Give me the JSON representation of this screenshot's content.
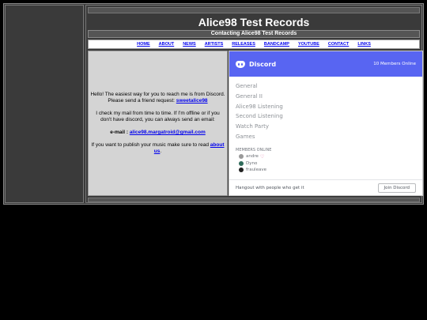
{
  "header": {
    "title": "Alice98 Test Records",
    "subtitle": "Contacting Alice98 Test Records"
  },
  "nav": {
    "items": [
      "HOME",
      "ABOUT",
      "NEWS",
      "ARTISTS",
      "RELEASES",
      "BANDCAMP",
      "YOUTUBE",
      "CONTACT",
      "LINKS"
    ]
  },
  "content": {
    "intro": "Hello! The easiest way for you to reach me is from Discord. Please send a friend request: ",
    "discord_user": "sweetalice98",
    "mail_text": "I check my mail from time to time. If I'm offline or if you don't have discord, you can always send an email:",
    "email_label": "e-mail : ",
    "email": "alice98.margatroid@gmail.com",
    "publish_text": "If you want to publish your music make sure to read ",
    "about_link": "about us",
    "publish_end": "."
  },
  "discord": {
    "brand": "Discord",
    "online": "10 Members Online",
    "channels": [
      "General",
      "General II",
      "Alice98 Listening",
      "Second Listening",
      "Watch Party",
      "Games"
    ],
    "members_title": "MEMBERS ONLINE",
    "members": [
      "andre",
      "Dyno",
      "frauleave"
    ],
    "tagline": "Hangout with people who get it",
    "join": "Join Discord"
  }
}
